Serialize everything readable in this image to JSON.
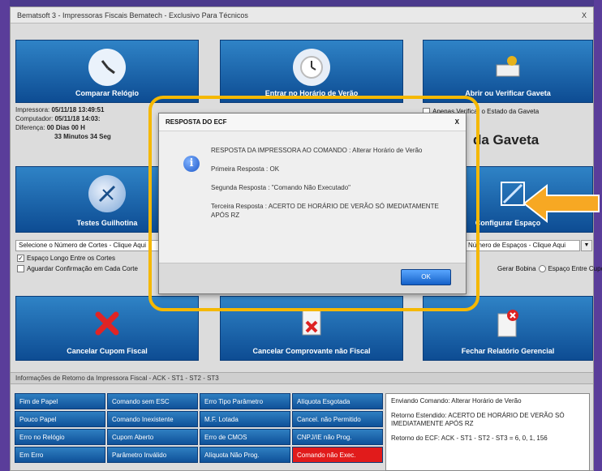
{
  "window": {
    "title": "Bematsoft 3 - Impressoras Fiscais Bematech - Exclusivo Para Técnicos",
    "close": "X"
  },
  "tiles": [
    {
      "label": "Comparar Relógio",
      "icon": "clock-hands-icon"
    },
    {
      "label": "Entrar no Horário de Verão",
      "icon": "clock-icon"
    },
    {
      "label": "Abrir ou Verificar Gaveta",
      "icon": "cash-drawer-icon"
    },
    {
      "label": "Testes Guilhotina",
      "icon": "cutter-icon"
    },
    {
      "label": "Configurar Espaço",
      "icon": "spacing-icon"
    },
    {
      "label": "Cancelar Cupom Fiscal",
      "icon": "red-x-icon"
    },
    {
      "label": "Cancelar Comprovante não Fiscal",
      "icon": "document-cancel-icon"
    },
    {
      "label": "Fechar Relatório Gerencial",
      "icon": "report-close-icon"
    }
  ],
  "clock_info": {
    "impressora_label": "Impressora:",
    "impressora_value": "05/11/18 13:49:51",
    "computador_label": "Computador:",
    "computador_value": "05/11/18 14:03:",
    "diferenca_label": "Diferença:",
    "diferenca_days": "00 Dias",
    "diferenca_minutes": "33 Minutos",
    "extra_1": "00 H",
    "extra_2": "34 Seg"
  },
  "gaveta": {
    "checkbox_label": "Apenas Verificar o Estado da Gaveta",
    "status_text": "da Gaveta"
  },
  "cortes": {
    "select_value": "Selecione o Número de Cortes - Clique Aqui",
    "opt1": "Espaço Longo Entre os Cortes",
    "opt2": "Aguardar Confirmação em Cada Corte"
  },
  "espaco": {
    "select_value": "Número de Espaços - Clique Aqui",
    "select_arrow": "▼",
    "opt_label": "Gerar Bobina",
    "opt2": "Espaço Entre Cupons"
  },
  "status_bar": "Informações de Retorno da Impressora Fiscal - ACK - ST1 - ST2 - ST3",
  "status_cells": [
    "Fim de Papel",
    "Comando sem ESC",
    "Erro Tipo Parâmetro",
    "Alíquota Esgotada",
    "Pouco Papel",
    "Comando Inexistente",
    "M.F. Lotada",
    "Cancel. não Permitido",
    "Erro no Relógio",
    "Cupom Aberto",
    "Erro de CMOS",
    "CNPJ/IE não Prog.",
    "Em Erro",
    "Parâmetro Inválido",
    "Alíquota Não Prog.",
    "Comando não Exec."
  ],
  "log": {
    "line1": "Enviando Comando: Alterar Horário de Verão",
    "line2": "Retorno Estendido: ACERTO DE HORÁRIO DE VERÃO SÓ IMEDIATAMENTE APÓS RZ",
    "line3": "Retorno do ECF: ACK - ST1 - ST2 - ST3 = 6, 0, 1, 156"
  },
  "dialog": {
    "title": "RESPOSTA DO ECF",
    "close": "X",
    "line1": "RESPOSTA DA IMPRESSORA AO COMANDO : Alterar Horário de Verão",
    "line2": "Primeira Resposta : OK",
    "line3": "Segunda Resposta : \"Comando Não Executado\"",
    "line4": "Terceira Resposta : ACERTO DE HORÁRIO DE VERÃO SÓ IMEDIATAMENTE APÓS RZ",
    "ok": "OK"
  },
  "colors": {
    "tile": "#1a63ad",
    "highlight": "#f5b800",
    "arrow": "#f7a823",
    "error_cell": "#e11b1b"
  }
}
